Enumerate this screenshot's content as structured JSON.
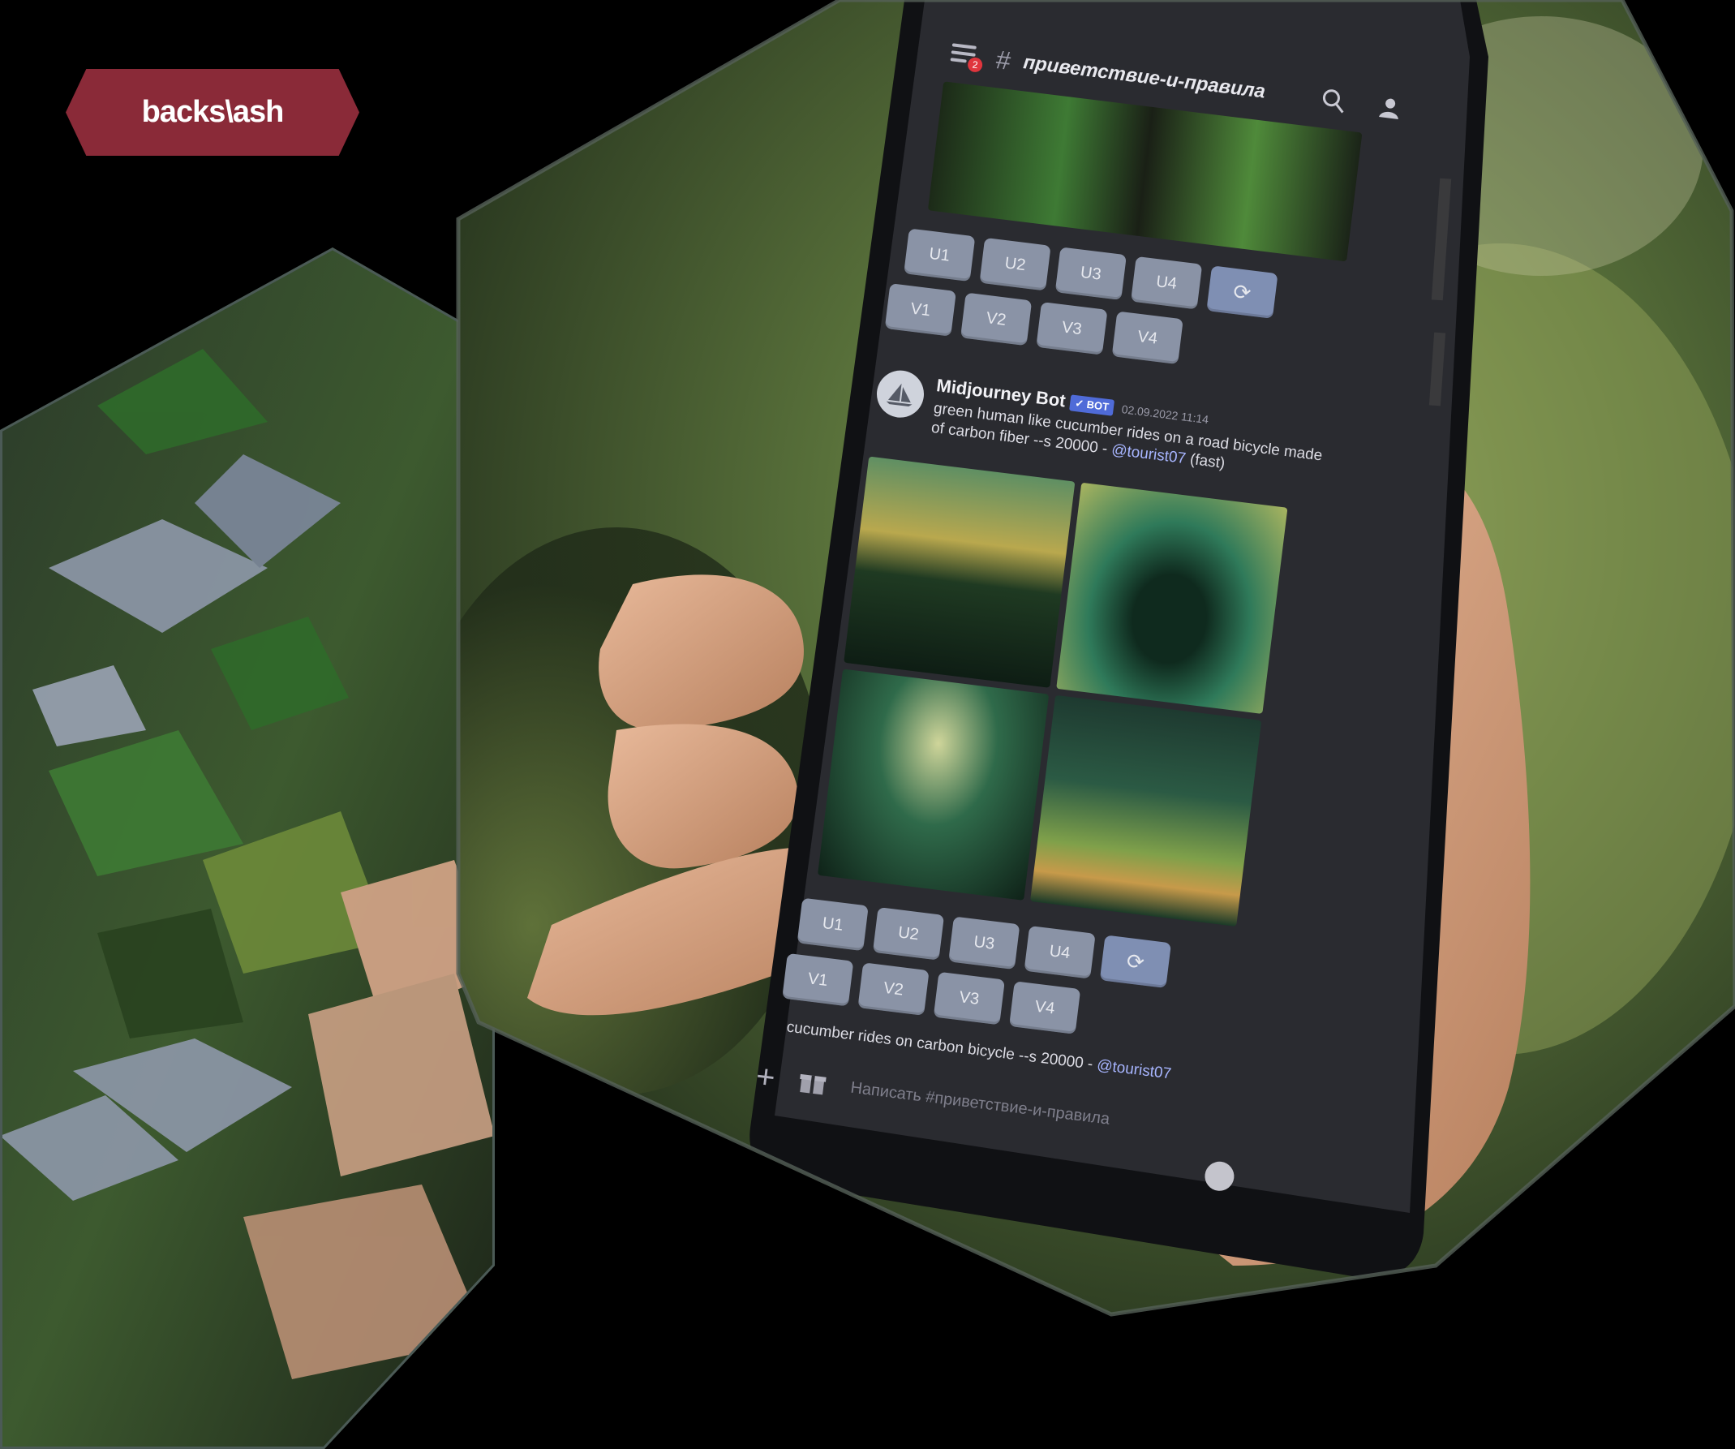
{
  "brand": {
    "logo_text": "backs\\ash"
  },
  "discord": {
    "notification_count": "2",
    "channel_name": "приветствие-и-правила",
    "upscale_buttons": [
      "U1",
      "U2",
      "U3",
      "U4"
    ],
    "variation_buttons": [
      "V1",
      "V2",
      "V3",
      "V4"
    ],
    "message": {
      "author": "Midjourney Bot",
      "bot_tag": "✓ BOT",
      "timestamp": "02.09.2022 11:14",
      "prompt": "green human like cucumber rides on a road bicycle made of carbon fiber --s 20000 - ",
      "mention": "@tourist07",
      "speed": "(fast)"
    },
    "next_message": {
      "text": "cucumber rides on carbon bicycle --s 20000 - ",
      "mention": "@tourist07"
    },
    "composer_placeholder": "Написать #приветствие-и-правила"
  },
  "colors": {
    "brand_bg": "#8a2a38",
    "button_bg": "#8a93a6",
    "bot_tag": "#4f6bd8",
    "mention": "#a7b5ff"
  }
}
